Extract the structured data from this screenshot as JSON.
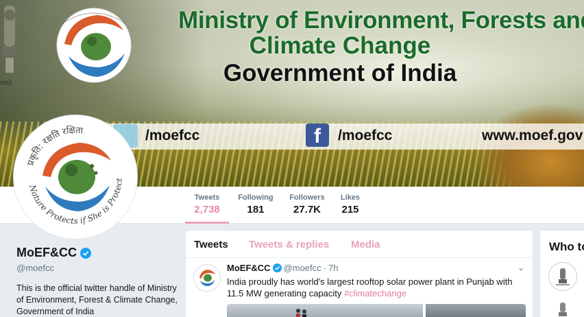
{
  "banner": {
    "title_line1": "Ministry of Environment, Forests and",
    "title_line2": "Climate Change",
    "title_line3": "Government of India",
    "emblem_text": "जयते",
    "twitter_handle": "/moefcc",
    "facebook_handle": "/moefcc",
    "facebook_glyph": "f",
    "website": "www.moef.gov",
    "logo_top_text": "प्रकृति: रक्षति रक्षिता",
    "logo_bottom_text": "Nature Protects if She is Protected"
  },
  "stats": {
    "tweets_label": "Tweets",
    "tweets_value": "2,738",
    "following_label": "Following",
    "following_value": "181",
    "followers_label": "Followers",
    "followers_value": "27.7K",
    "likes_label": "Likes",
    "likes_value": "215"
  },
  "profile": {
    "name": "MoEF&CC",
    "handle": "@moefcc",
    "bio": "This is the official twitter handle of Ministry of Environment, Forest & Climate Change, Government of India"
  },
  "timeline": {
    "tab_tweets": "Tweets",
    "tab_replies": "Tweets & replies",
    "tab_media": "Media",
    "tweet": {
      "name": "MoEF&CC",
      "handle": "@moefcc",
      "separator": "·",
      "time": "7h",
      "text": "India proudly has world's largest rooftop solar power plant in Punjab with 11.5 MW generating capacity",
      "hashtag": "#climatechange",
      "chevron": "⌄"
    }
  },
  "who_to_follow": {
    "title": "Who to"
  },
  "colors": {
    "accent_pink": "#e0245e",
    "verified_blue": "#1da1f2",
    "title_green": "#1a6b2a"
  }
}
